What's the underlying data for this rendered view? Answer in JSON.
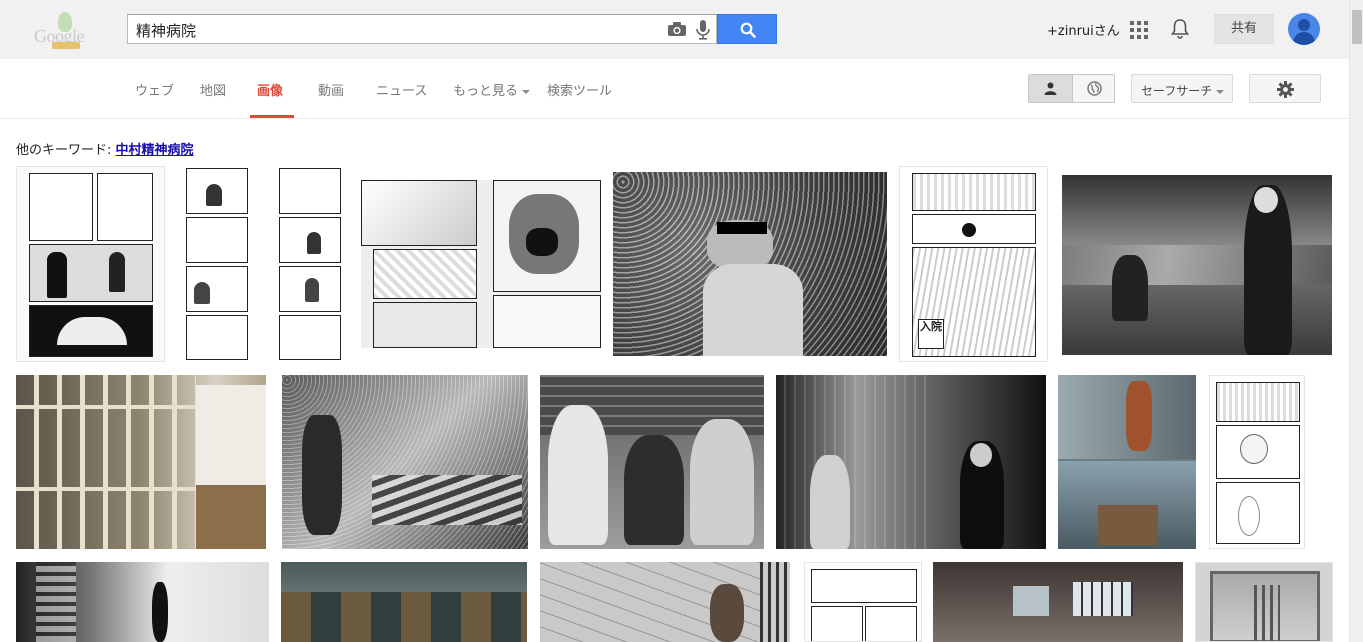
{
  "search": {
    "query": "精神病院"
  },
  "header": {
    "user_label": "+zinruiさん",
    "share_label": "共有"
  },
  "nav": {
    "tabs": [
      {
        "label": "ウェブ"
      },
      {
        "label": "地図"
      },
      {
        "label": "画像"
      },
      {
        "label": "動画"
      },
      {
        "label": "ニュース"
      },
      {
        "label": "もっと見る"
      },
      {
        "label": "検索ツール"
      }
    ],
    "safesearch_label": "セーフサーチ"
  },
  "related": {
    "prefix": "他のキーワード:",
    "keyword": "中村精神病院"
  },
  "results": {
    "thumb_texts": {
      "nyuin": "入院"
    }
  },
  "colors": {
    "accent_blue": "#4285f4",
    "active_tab_red": "#dd4b39",
    "link": "#1a0dab"
  },
  "icons": [
    "camera-icon",
    "mic-icon",
    "search-icon",
    "apps-grid-icon",
    "bell-icon",
    "person-icon",
    "globe-icon",
    "gear-icon",
    "avatar"
  ]
}
